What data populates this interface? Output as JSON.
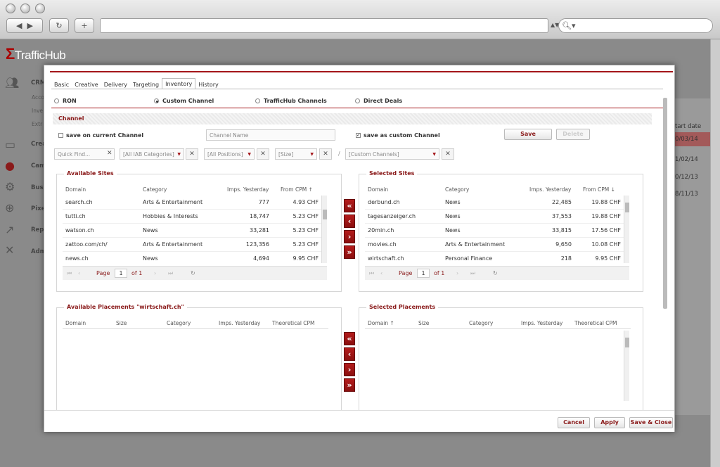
{
  "browser": {
    "search_icon": "magnifier-icon"
  },
  "app": {
    "logo_text": "TrafficHub",
    "logo_mark": "Σ",
    "sidebar": [
      {
        "label": "CRM",
        "icon": "people-icon"
      },
      {
        "label": "Crea",
        "icon": "folder-icon"
      },
      {
        "label": "Cam",
        "icon": "globe-icon"
      },
      {
        "label": "Busi",
        "icon": "gear-icon"
      },
      {
        "label": "Pixe",
        "icon": "crosshair-icon"
      },
      {
        "label": "Repo",
        "icon": "chart-icon"
      },
      {
        "label": "Adm",
        "icon": "tools-icon"
      }
    ],
    "sidebar_sub": [
      "Acco",
      "Inve",
      "Extr"
    ],
    "bg_table": {
      "header": "tart date",
      "rows": [
        "0/03/14",
        "1/02/14",
        "0/12/13",
        "8/11/13"
      ]
    }
  },
  "modal": {
    "tabs": [
      {
        "label": "Basic",
        "active": false
      },
      {
        "label": "Creative",
        "active": false
      },
      {
        "label": "Delivery",
        "active": false
      },
      {
        "label": "Targeting",
        "active": false
      },
      {
        "label": "Inventory",
        "active": true
      },
      {
        "label": "History",
        "active": false
      }
    ],
    "radios": [
      {
        "label": "RON",
        "checked": false
      },
      {
        "label": "Custom Channel",
        "checked": true
      },
      {
        "label": "TrafficHub Channels",
        "checked": false
      },
      {
        "label": "Direct Deals",
        "checked": false
      }
    ],
    "channel": {
      "header": "Channel",
      "save_current_label": "save on current Channel",
      "save_current_checked": false,
      "name_placeholder": "Channel Name",
      "save_custom_label": "save as custom Channel",
      "save_custom_checked": true,
      "save_button": "Save",
      "delete_button": "Delete"
    },
    "filters": {
      "quick_find_placeholder": "Quick Find...",
      "iab": "[All IAB Categories]",
      "positions": "[All Positions]",
      "size": "[Size]",
      "separator": "/",
      "custom_channels": "[Custom Channels]",
      "clear_glyph": "✕"
    },
    "available_sites": {
      "title": "Available Sites",
      "columns": [
        "Domain",
        "Category",
        "Imps. Yesterday",
        "From CPM ↑"
      ],
      "rows": [
        [
          "search.ch",
          "Arts & Entertainment",
          "777",
          "4.93 CHF"
        ],
        [
          "tutti.ch",
          "Hobbies & Interests",
          "18,747",
          "5.23 CHF"
        ],
        [
          "watson.ch",
          "News",
          "33,281",
          "5.23 CHF"
        ],
        [
          "zattoo.com/ch/",
          "Arts & Entertainment",
          "123,356",
          "5.23 CHF"
        ],
        [
          "news.ch",
          "News",
          "4,694",
          "9.95 CHF"
        ]
      ],
      "pager": {
        "page_label": "Page",
        "page": "1",
        "of_label": "of 1"
      }
    },
    "selected_sites": {
      "title": "Selected Sites",
      "columns": [
        "Domain",
        "Category",
        "Imps. Yesterday",
        "From CPM ↓"
      ],
      "rows": [
        [
          "derbund.ch",
          "News",
          "22,485",
          "19.88 CHF"
        ],
        [
          "tagesanzeiger.ch",
          "News",
          "37,553",
          "19.88 CHF"
        ],
        [
          "20min.ch",
          "News",
          "33,815",
          "17.56 CHF"
        ],
        [
          "movies.ch",
          "Arts & Entertainment",
          "9,650",
          "10.08 CHF"
        ],
        [
          "wirtschaft.ch",
          "Personal Finance",
          "218",
          "9.95 CHF"
        ]
      ],
      "pager": {
        "page_label": "Page",
        "page": "1",
        "of_label": "of 1"
      }
    },
    "transfer_buttons": [
      "«",
      "‹",
      "›",
      "»"
    ],
    "available_placements": {
      "title": "Available Placements \"wirtschaft.ch\"",
      "columns": [
        "Domain",
        "Size",
        "Category",
        "Imps. Yesterday",
        "Theoretical CPM"
      ]
    },
    "selected_placements": {
      "title": "Selected Placements",
      "columns": [
        "Domain ↑",
        "Size",
        "Category",
        "Imps. Yesterday",
        "Theoretical CPM"
      ]
    },
    "footer": {
      "cancel": "Cancel",
      "apply": "Apply",
      "save_close": "Save & Close"
    }
  }
}
